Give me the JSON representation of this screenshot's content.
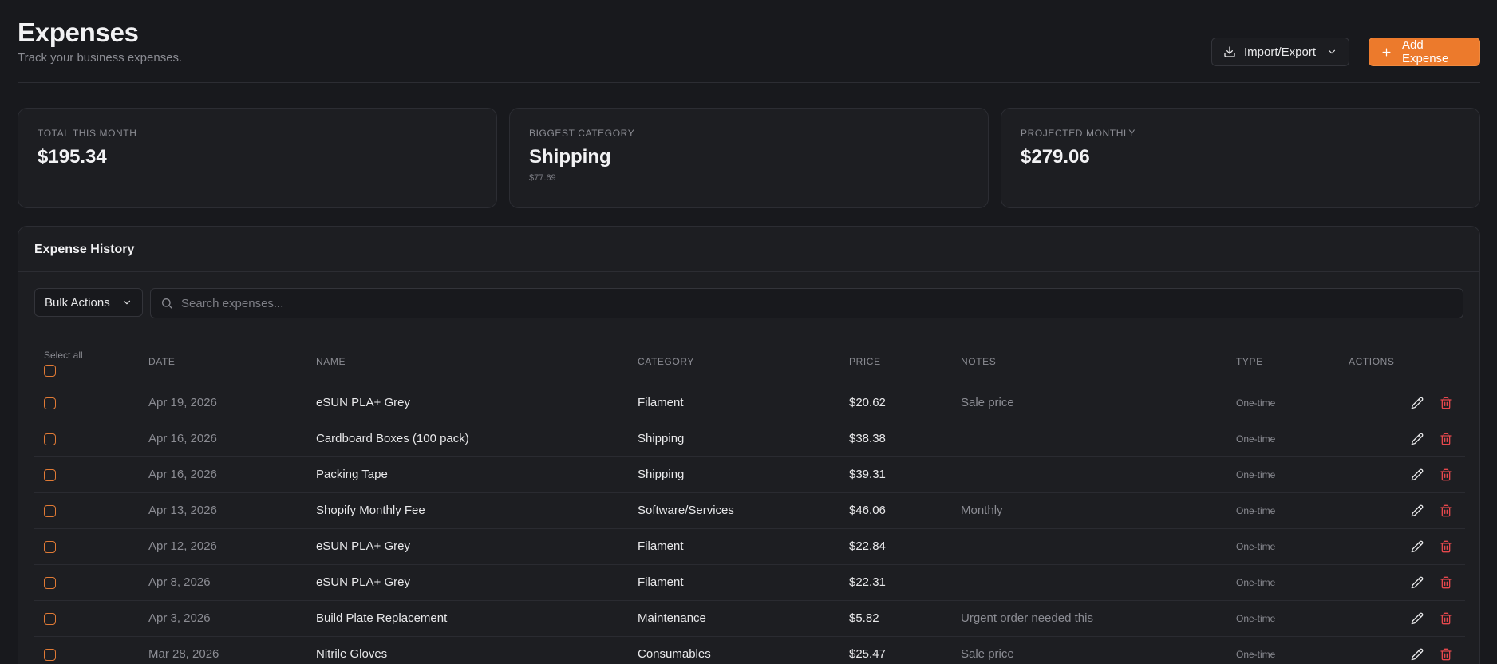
{
  "header": {
    "title": "Expenses",
    "subtitle": "Track your business expenses.",
    "import_export_label": "Import/Export",
    "add_expense_label": "Add Expense"
  },
  "stats": [
    {
      "label": "TOTAL THIS MONTH",
      "value": "$195.34",
      "sub": ""
    },
    {
      "label": "BIGGEST CATEGORY",
      "value": "Shipping",
      "sub": "$77.69"
    },
    {
      "label": "PROJECTED MONTHLY",
      "value": "$279.06",
      "sub": ""
    }
  ],
  "history": {
    "title": "Expense History",
    "bulk_actions_label": "Bulk Actions",
    "search_placeholder": "Search expenses...",
    "select_all_label": "Select all",
    "columns": [
      "DATE",
      "NAME",
      "CATEGORY",
      "PRICE",
      "NOTES",
      "TYPE",
      "ACTIONS"
    ],
    "rows": [
      {
        "date": "Apr 19, 2026",
        "name": "eSUN PLA+ Grey",
        "category": "Filament",
        "price": "$20.62",
        "notes": "Sale price",
        "type": "One-time"
      },
      {
        "date": "Apr 16, 2026",
        "name": "Cardboard Boxes (100 pack)",
        "category": "Shipping",
        "price": "$38.38",
        "notes": "",
        "type": "One-time"
      },
      {
        "date": "Apr 16, 2026",
        "name": "Packing Tape",
        "category": "Shipping",
        "price": "$39.31",
        "notes": "",
        "type": "One-time"
      },
      {
        "date": "Apr 13, 2026",
        "name": "Shopify Monthly Fee",
        "category": "Software/Services",
        "price": "$46.06",
        "notes": "Monthly",
        "type": "One-time"
      },
      {
        "date": "Apr 12, 2026",
        "name": "eSUN PLA+ Grey",
        "category": "Filament",
        "price": "$22.84",
        "notes": "",
        "type": "One-time"
      },
      {
        "date": "Apr 8, 2026",
        "name": "eSUN PLA+ Grey",
        "category": "Filament",
        "price": "$22.31",
        "notes": "",
        "type": "One-time"
      },
      {
        "date": "Apr 3, 2026",
        "name": "Build Plate Replacement",
        "category": "Maintenance",
        "price": "$5.82",
        "notes": "Urgent order needed this",
        "type": "One-time"
      },
      {
        "date": "Mar 28, 2026",
        "name": "Nitrile Gloves",
        "category": "Consumables",
        "price": "$25.47",
        "notes": "Sale price",
        "type": "One-time"
      }
    ]
  },
  "colors": {
    "accent": "#ec7a2c",
    "background": "#18191d",
    "card": "#1d1e22",
    "danger": "#e5484d"
  },
  "icons": {
    "import": "download-icon",
    "dropdown": "chevron-down-icon",
    "add": "plus-icon",
    "search": "search-icon",
    "edit": "pencil-icon",
    "delete": "trash-icon"
  }
}
